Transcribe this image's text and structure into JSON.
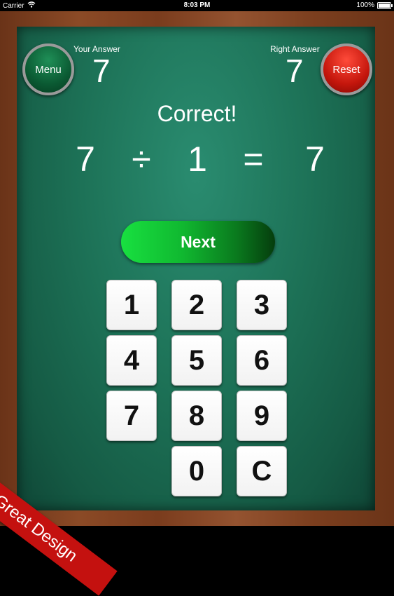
{
  "status_bar": {
    "carrier": "Carrier",
    "time": "8:03 PM",
    "battery": "100%"
  },
  "menu_button": {
    "label": "Menu"
  },
  "reset_button": {
    "label": "Reset"
  },
  "your_answer": {
    "label": "Your Answer",
    "value": "7"
  },
  "right_answer": {
    "label": "Right Answer",
    "value": "7"
  },
  "result": {
    "text": "Correct!"
  },
  "equation": {
    "left": "7",
    "operator": "÷",
    "right": "1",
    "equals": "=",
    "answer": "7"
  },
  "next_button": {
    "label": "Next"
  },
  "keypad": {
    "keys": [
      "1",
      "2",
      "3",
      "4",
      "5",
      "6",
      "7",
      "8",
      "9",
      "0",
      "C"
    ]
  },
  "ribbon": {
    "text": "Great Design"
  },
  "colors": {
    "board": "#1d7257",
    "menu": "#0b5a33",
    "reset": "#c4160c",
    "next": "#10b830",
    "ribbon": "#c4110f"
  }
}
